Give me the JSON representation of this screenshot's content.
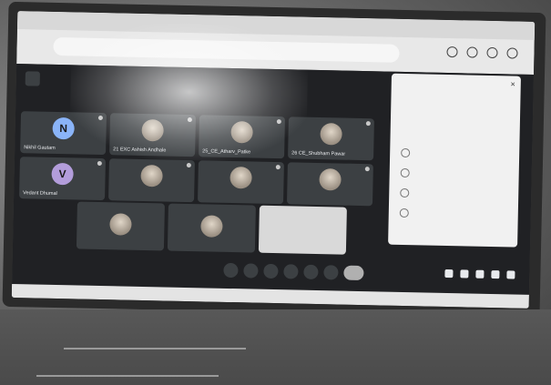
{
  "meeting": {
    "participants_row1": [
      {
        "initial": "N",
        "name": "Nikhil Gautam",
        "avatar": "letter"
      },
      {
        "initial": "",
        "name": "21 EXC Ashish Andhale",
        "avatar": "photo"
      },
      {
        "initial": "",
        "name": "25_CE_Atharv_Patke",
        "avatar": "photo"
      },
      {
        "initial": "",
        "name": "26 CE_Shubham Pawar",
        "avatar": "photo"
      }
    ],
    "participants_row2": [
      {
        "initial": "V",
        "name": "Vedant Dhumal",
        "avatar": "letter"
      },
      {
        "initial": "",
        "name": "",
        "avatar": "photo"
      },
      {
        "initial": "",
        "name": "",
        "avatar": "photo"
      },
      {
        "initial": "",
        "name": "",
        "avatar": "photo"
      }
    ],
    "info_text": "",
    "accent": "#8ab4f8",
    "background": "#202124"
  },
  "icons": {
    "meet_logo": "meet-logo-icon",
    "close": "close-icon",
    "controls": [
      "mic-icon",
      "camera-icon",
      "captions-icon",
      "raise-hand-icon",
      "present-icon",
      "more-icon",
      "leave-call-icon"
    ],
    "right": [
      "info-icon",
      "people-icon",
      "chat-icon",
      "activities-icon",
      "lock-icon"
    ]
  },
  "side_panel": {
    "close_label": "×"
  }
}
